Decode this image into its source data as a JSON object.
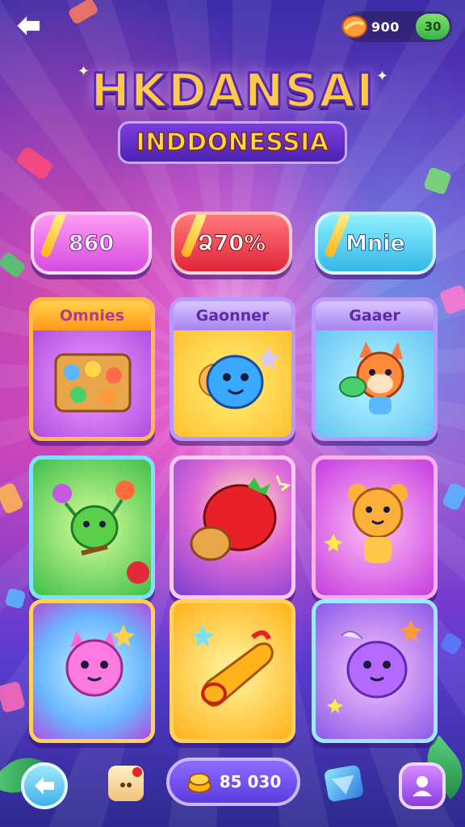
{
  "header": {
    "back_icon": "back-arrow-icon",
    "currency": {
      "icon": "candy-coin-icon",
      "amount": "900",
      "badge": "30"
    }
  },
  "title": {
    "main": "HKDANSAI",
    "sub": "INDDONESSIA"
  },
  "stats": [
    {
      "label": "860"
    },
    {
      "label": "Ձ70%"
    },
    {
      "label": "Mnie"
    }
  ],
  "cards": [
    {
      "label": "Omnies",
      "icon": "board-game-icon"
    },
    {
      "label": "Gaonner",
      "icon": "blue-blob-character-icon"
    },
    {
      "label": "Gaaer",
      "icon": "fox-character-icon"
    },
    {
      "label": "",
      "icon": "green-alien-character-icon"
    },
    {
      "label": "",
      "icon": "tomato-rocket-icon"
    },
    {
      "label": "",
      "icon": "tiger-character-icon"
    },
    {
      "label": "",
      "icon": "pink-cat-character-icon"
    },
    {
      "label": "",
      "icon": "golden-candy-icon"
    },
    {
      "label": "",
      "icon": "purple-bunny-character-icon"
    }
  ],
  "footer": {
    "back_icon": "back-arrow-icon",
    "gift_icon": "gift-icon",
    "coins_icon": "coin-stack-icon",
    "coins_value": "85 030",
    "gem_icon": "gem-icon",
    "profile_icon": "profile-icon"
  },
  "colors": {
    "title_gold": "#ffc94a",
    "title_outline": "#5a2bb0",
    "pill_pink": "#d64be0",
    "pill_red": "#e1243a",
    "pill_cyan": "#35b8e8"
  }
}
